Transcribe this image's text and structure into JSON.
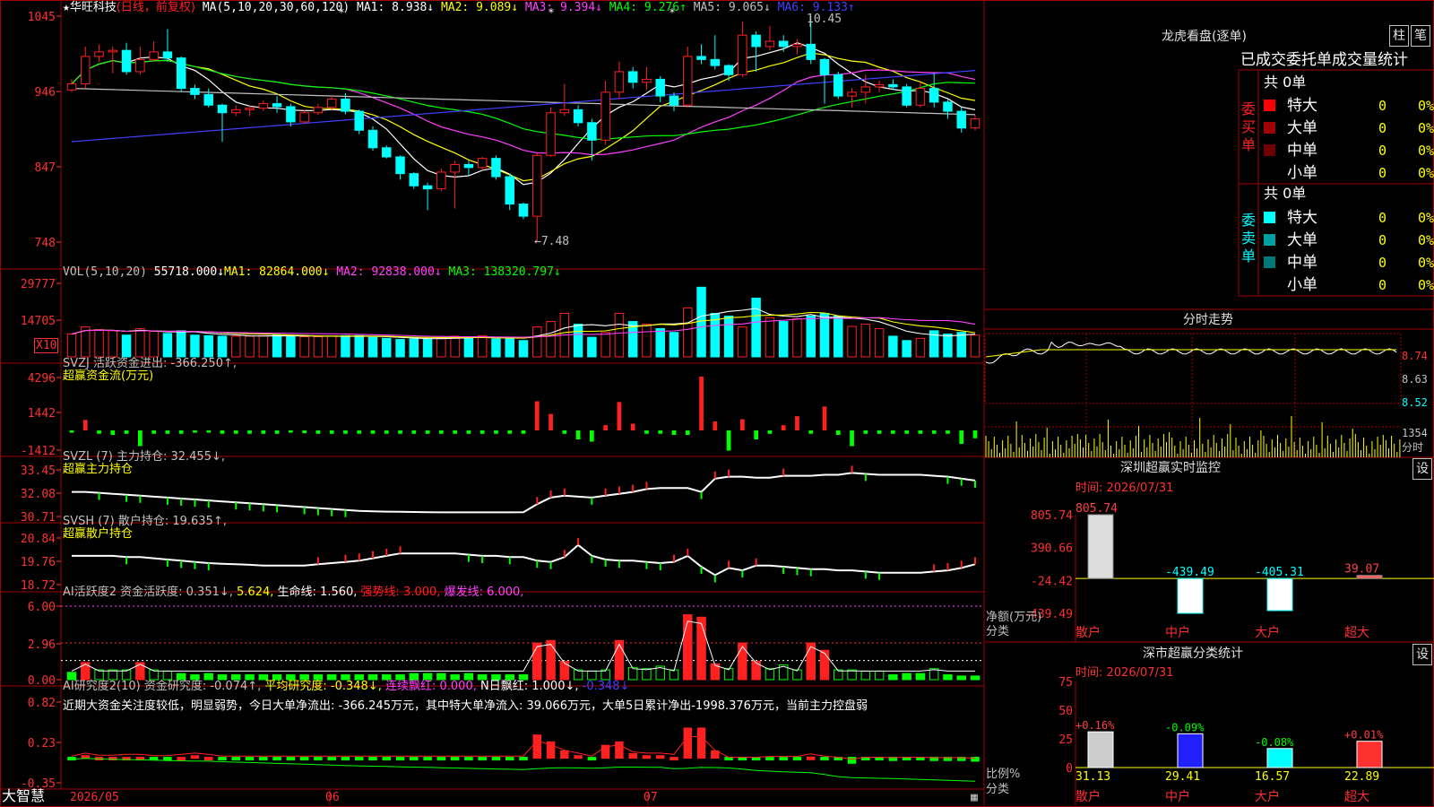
{
  "colors": {
    "up": "#ff2020",
    "down": "#00ffff",
    "grid": "#a00000",
    "white": "#ffffff",
    "yellow": "#ffff00",
    "magenta": "#ff40ff",
    "green": "#00ff00",
    "blue": "#4040ff",
    "gray": "#c0c0c0"
  },
  "main": {
    "title_stock": "华旺科技",
    "title_mode": "(日线，前复权)",
    "ma_header": "MA(5,10,20,30,60,120)",
    "ma1": "MA1: 8.938↓",
    "ma2": "MA2: 9.089↓",
    "ma3": "MA3: 9.394↓",
    "ma4": "MA4: 9.276↑",
    "ma5": "MA5: 9.065↓",
    "ma6": "MA6: 9.133↑",
    "yticks": [
      "1045",
      "946",
      "847",
      "748"
    ],
    "high_label": "10.45",
    "low_label": "←7.48"
  },
  "vol": {
    "header": "VOL(5,10,20)",
    "value": "55718.000↓",
    "ma1": "MA1: 82864.000↓",
    "ma2": "MA2: 92838.000↓",
    "ma3": "MA3: 138320.797↓",
    "yticks": [
      "29777",
      "14705"
    ],
    "unit": "X10"
  },
  "svzj": {
    "header": "SVZJ  活跃资金进出: -366.250↑,",
    "sub": "超赢资金流(万元)",
    "yticks": [
      "4296",
      "1442",
      "-1412"
    ]
  },
  "svzl": {
    "header": "SVZL (7) 主力持仓: 32.455↓,",
    "sub": "超赢主力持仓",
    "yticks": [
      "33.45",
      "32.08",
      "30.71"
    ]
  },
  "svsh": {
    "header": "SVSH (7) 散户持仓: 19.635↑,",
    "sub": "超赢散户持仓",
    "yticks": [
      "20.84",
      "19.76",
      "18.72"
    ]
  },
  "ai1": {
    "header": "AI活跃度2 资金活跃度: 0.351↓,",
    "v2": "5.624,",
    "v3": "生命线: 1.560,",
    "v4": "强势线: 3.000,",
    "v5": "爆发线: 6.000,",
    "yticks": [
      "6.00",
      "2.96",
      "0.00"
    ]
  },
  "ai2": {
    "header": "AI研究度2(10) 资金研究度: -0.074↑,",
    "v2": "平均研究度: -0.348↓,",
    "v3": "连续飘红: 0.000,",
    "v4": "N日飘红: 1.000↓,",
    "v5": "-0.348↓",
    "comment": "近期大资金关注度较低，明显弱势，今日大单净流出: -366.245万元，其中特大单净流入: 39.066万元，大单5日累计净出-1998.376万元，当前主力控盘弱",
    "yticks": [
      "0.82",
      "0.23",
      "-0.35"
    ]
  },
  "xaxis": {
    "brand": "大智慧",
    "labels": [
      "2026/05",
      "06",
      "07"
    ]
  },
  "right": {
    "lhkp_title": "龙虎看盘(逐单)",
    "btn_zhu": "柱",
    "btn_bi": "笔",
    "tabs": [
      "已成交",
      "委托单",
      "成交量统计"
    ],
    "buy_label": "委买单",
    "sell_label": "委卖单",
    "buy_total": "共 0单",
    "sell_total": "共 0单",
    "buy_rows": [
      {
        "name": "特大",
        "n": "0",
        "p": "0%"
      },
      {
        "name": "大单",
        "n": "0",
        "p": "0%"
      },
      {
        "name": "中单",
        "n": "0",
        "p": "0%"
      },
      {
        "name": "小单",
        "n": "0",
        "p": "0%"
      }
    ],
    "sell_rows": [
      {
        "name": "特大",
        "n": "0",
        "p": "0%"
      },
      {
        "name": "大单",
        "n": "0",
        "p": "0%"
      },
      {
        "name": "中单",
        "n": "0",
        "p": "0%"
      },
      {
        "name": "小单",
        "n": "0",
        "p": "0%"
      }
    ],
    "fs_title": "分时走势",
    "fs_ticks": [
      "8.74",
      "8.63",
      "8.52"
    ],
    "fs_vol": "1354",
    "fs_vol_unit": "分时",
    "sz_title": "深圳超赢实时监控",
    "sz_btn": "设",
    "sz_time": "时间: 2026/07/31",
    "sz_ticks": [
      "805.74",
      "390.66",
      "-24.42",
      "-439.49"
    ],
    "sz_unit1": "净额(万元)",
    "sz_unit2": "分类",
    "sz_bars": [
      {
        "cat": "散户",
        "val": "805.74"
      },
      {
        "cat": "中户",
        "val": "-439.49"
      },
      {
        "cat": "大户",
        "val": "-405.31"
      },
      {
        "cat": "超大",
        "val": "39.07"
      }
    ],
    "ss_title": "深市超赢分类统计",
    "ss_btn": "设",
    "ss_time": "时间: 2026/07/31",
    "ss_ticks": [
      "75",
      "50",
      "25",
      "0"
    ],
    "ss_unit1": "比例%",
    "ss_unit2": "分类",
    "ss_bars": [
      {
        "cat": "散户",
        "top": "+0.16%",
        "val": "31.13"
      },
      {
        "cat": "中户",
        "top": "-0.09%",
        "val": "29.41"
      },
      {
        "cat": "大户",
        "top": "-0.08%",
        "val": "16.57"
      },
      {
        "cat": "超大",
        "top": "+0.01%",
        "val": "22.89"
      }
    ]
  },
  "chart_data": {
    "type": "candlestick",
    "candles": [
      [
        9.48,
        9.56,
        9.62,
        9.45
      ],
      [
        9.56,
        9.92,
        10.05,
        9.5
      ],
      [
        9.92,
        9.98,
        10.08,
        9.85
      ],
      [
        9.98,
        10.0,
        10.05,
        9.7
      ],
      [
        10.0,
        9.72,
        10.1,
        9.68
      ],
      [
        9.72,
        9.88,
        10.05,
        9.68
      ],
      [
        9.88,
        9.98,
        10.12,
        9.86
      ],
      [
        9.98,
        9.9,
        10.28,
        9.85
      ],
      [
        9.9,
        9.5,
        9.92,
        9.45
      ],
      [
        9.5,
        9.42,
        9.55,
        9.36
      ],
      [
        9.42,
        9.28,
        9.5,
        9.25
      ],
      [
        9.28,
        9.18,
        9.3,
        8.8
      ],
      [
        9.18,
        9.22,
        9.28,
        9.14
      ],
      [
        9.22,
        9.24,
        9.28,
        9.14
      ],
      [
        9.24,
        9.3,
        9.34,
        9.2
      ],
      [
        9.3,
        9.26,
        9.4,
        9.18
      ],
      [
        9.26,
        9.06,
        9.3,
        9.0
      ],
      [
        9.06,
        9.18,
        9.22,
        9.04
      ],
      [
        9.18,
        9.25,
        9.3,
        9.15
      ],
      [
        9.25,
        9.36,
        9.4,
        9.22
      ],
      [
        9.36,
        9.2,
        9.44,
        9.16
      ],
      [
        9.2,
        8.95,
        9.22,
        8.9
      ],
      [
        8.95,
        8.72,
        9.0,
        8.68
      ],
      [
        8.72,
        8.6,
        8.75,
        8.58
      ],
      [
        8.6,
        8.38,
        8.62,
        8.3
      ],
      [
        8.38,
        8.22,
        8.4,
        8.18
      ],
      [
        8.22,
        8.18,
        8.26,
        7.9
      ],
      [
        8.18,
        8.4,
        8.45,
        8.15
      ],
      [
        8.4,
        8.5,
        8.55,
        7.92
      ],
      [
        8.5,
        8.46,
        8.55,
        8.35
      ],
      [
        8.46,
        8.58,
        8.6,
        8.42
      ],
      [
        8.58,
        8.34,
        8.62,
        8.3
      ],
      [
        8.34,
        7.98,
        8.38,
        7.9
      ],
      [
        7.98,
        7.82,
        8.0,
        7.78
      ],
      [
        7.82,
        8.62,
        8.65,
        7.48
      ],
      [
        8.62,
        9.18,
        9.25,
        8.6
      ],
      [
        9.18,
        9.22,
        9.56,
        9.14
      ],
      [
        9.22,
        9.05,
        9.28,
        9.0
      ],
      [
        9.05,
        8.82,
        9.1,
        8.55
      ],
      [
        8.82,
        9.45,
        9.6,
        8.76
      ],
      [
        9.45,
        9.72,
        9.85,
        9.36
      ],
      [
        9.72,
        9.58,
        9.78,
        9.5
      ],
      [
        9.58,
        9.62,
        9.78,
        9.48
      ],
      [
        9.62,
        9.4,
        9.66,
        9.32
      ],
      [
        9.4,
        9.28,
        9.45,
        9.2
      ],
      [
        9.28,
        9.92,
        10.05,
        9.25
      ],
      [
        9.92,
        9.88,
        10.08,
        9.82
      ],
      [
        9.88,
        9.8,
        10.2,
        9.75
      ],
      [
        9.8,
        9.68,
        9.82,
        9.6
      ],
      [
        9.68,
        10.2,
        10.38,
        9.65
      ],
      [
        10.2,
        10.05,
        10.25,
        9.72
      ],
      [
        10.05,
        10.12,
        10.32,
        10.0
      ],
      [
        10.12,
        10.05,
        10.2,
        9.98
      ],
      [
        10.05,
        10.08,
        10.15,
        9.95
      ],
      [
        10.08,
        9.88,
        10.45,
        9.82
      ],
      [
        9.88,
        9.68,
        9.9,
        9.3
      ],
      [
        9.68,
        9.4,
        9.72,
        9.36
      ],
      [
        9.4,
        9.45,
        9.5,
        9.25
      ],
      [
        9.45,
        9.52,
        9.68,
        9.3
      ],
      [
        9.52,
        9.55,
        9.6,
        9.45
      ],
      [
        9.55,
        9.52,
        9.62,
        9.48
      ],
      [
        9.52,
        9.28,
        9.56,
        9.25
      ],
      [
        9.28,
        9.5,
        9.58,
        9.25
      ],
      [
        9.5,
        9.32,
        9.7,
        9.25
      ],
      [
        9.32,
        9.2,
        9.35,
        9.1
      ],
      [
        9.2,
        8.98,
        9.25,
        8.92
      ],
      [
        8.98,
        9.1,
        9.15,
        8.95
      ]
    ],
    "volume": [
      42000,
      55000,
      50000,
      48000,
      40000,
      52000,
      47000,
      43000,
      48000,
      40000,
      39000,
      38000,
      38000,
      38000,
      39000,
      40000,
      38000,
      37000,
      37000,
      38000,
      39000,
      39000,
      36000,
      34000,
      32000,
      33000,
      33000,
      35000,
      38000,
      36000,
      39000,
      33000,
      35000,
      30000,
      55000,
      65000,
      80000,
      60000,
      36000,
      45000,
      80000,
      65000,
      60000,
      52000,
      45000,
      90000,
      128000,
      80000,
      75000,
      55000,
      108000,
      72000,
      65000,
      70000,
      75000,
      80000,
      75000,
      56000,
      60000,
      52000,
      38000,
      30000,
      34000,
      48000,
      42000,
      45000,
      40000
    ],
    "svzj": [
      -200,
      1400,
      -300,
      -400,
      -300,
      -1400,
      -300,
      -300,
      -300,
      -200,
      -200,
      -300,
      -300,
      -300,
      -300,
      -300,
      -200,
      -250,
      -300,
      -300,
      -300,
      -300,
      -300,
      -300,
      -300,
      -300,
      -300,
      -300,
      -300,
      -300,
      -300,
      -300,
      -300,
      -300,
      3900,
      2200,
      -300,
      -800,
      -1000,
      700,
      3800,
      900,
      -300,
      -300,
      -400,
      -400,
      7200,
      1200,
      -1800,
      1500,
      -800,
      -300,
      700,
      1900,
      -300,
      3200,
      -400,
      -1400,
      -300,
      -300,
      -300,
      -300,
      -300,
      -300,
      -300,
      -1200,
      -700
    ],
    "svzl": [
      32.1,
      32.1,
      32.05,
      32.0,
      31.95,
      31.9,
      31.85,
      31.8,
      31.75,
      31.7,
      31.65,
      31.6,
      31.55,
      31.5,
      31.45,
      31.4,
      31.35,
      31.3,
      31.25,
      31.2,
      31.15,
      31.1,
      31.08,
      31.06,
      31.05,
      31.04,
      31.03,
      31.02,
      31.02,
      31.02,
      31.02,
      31.02,
      31.02,
      31.03,
      31.45,
      31.8,
      31.9,
      31.85,
      31.8,
      31.9,
      32.0,
      32.1,
      32.25,
      32.3,
      32.3,
      32.3,
      32.1,
      32.8,
      32.9,
      32.9,
      32.85,
      32.85,
      32.95,
      32.95,
      32.95,
      33.0,
      33.0,
      33.1,
      33.05,
      33.0,
      33.0,
      33.0,
      33.0,
      32.95,
      32.9,
      32.8,
      32.7
    ],
    "svsh": [
      19.95,
      19.95,
      19.95,
      19.95,
      19.9,
      19.9,
      19.85,
      19.8,
      19.75,
      19.7,
      19.65,
      19.62,
      19.6,
      19.58,
      19.55,
      19.55,
      19.55,
      19.55,
      19.6,
      19.65,
      19.7,
      19.75,
      19.85,
      19.95,
      20.05,
      20.05,
      20.05,
      20.05,
      20.05,
      20.0,
      19.95,
      19.95,
      19.9,
      19.9,
      19.75,
      19.7,
      19.9,
      20.4,
      19.95,
      19.8,
      19.75,
      19.75,
      19.7,
      19.65,
      19.7,
      19.95,
      19.5,
      19.15,
      19.45,
      19.35,
      19.55,
      19.55,
      19.5,
      19.45,
      19.4,
      19.4,
      19.35,
      19.35,
      19.3,
      19.25,
      19.25,
      19.25,
      19.25,
      19.3,
      19.35,
      19.45,
      19.6
    ],
    "ai1": [
      0.6,
      1.4,
      0.8,
      0.8,
      0.8,
      1.4,
      0.8,
      0.7,
      0.5,
      0.4,
      0.5,
      0.4,
      0.4,
      0.4,
      0.4,
      0.4,
      0.4,
      0.4,
      0.4,
      0.4,
      0.4,
      0.4,
      0.4,
      0.4,
      0.4,
      0.5,
      0.5,
      0.5,
      0.4,
      0.5,
      0.4,
      0.4,
      0.4,
      0.4,
      3.0,
      3.2,
      1.5,
      0.8,
      0.7,
      0.8,
      3.2,
      1.0,
      0.9,
      1.1,
      0.8,
      5.3,
      5.1,
      1.3,
      0.9,
      3.0,
      1.5,
      0.9,
      1.2,
      0.8,
      3.0,
      2.4,
      0.8,
      0.8,
      0.7,
      0.7,
      0.4,
      0.5,
      0.5,
      0.9,
      0.4,
      0.3,
      0.3
    ],
    "ai2": [
      -0.02,
      0.05,
      0.0,
      0.0,
      0.02,
      0.02,
      -0.01,
      -0.01,
      0.02,
      0.05,
      0.02,
      -0.02,
      -0.02,
      -0.02,
      -0.02,
      -0.02,
      -0.02,
      -0.02,
      -0.02,
      -0.02,
      -0.02,
      -0.02,
      -0.02,
      -0.02,
      -0.02,
      -0.02,
      -0.02,
      -0.02,
      -0.02,
      -0.02,
      -0.02,
      -0.02,
      -0.02,
      -0.02,
      0.35,
      0.25,
      0.12,
      0.05,
      -0.02,
      0.2,
      0.25,
      0.08,
      0.05,
      0.05,
      0.02,
      0.45,
      0.45,
      0.12,
      -0.05,
      -0.05,
      -0.05,
      -0.03,
      -0.03,
      -0.03,
      0.03,
      -0.02,
      -0.05,
      -0.1,
      -0.05,
      -0.05,
      -0.06,
      -0.05,
      -0.05,
      -0.06,
      -0.06,
      -0.06,
      -0.07
    ]
  }
}
